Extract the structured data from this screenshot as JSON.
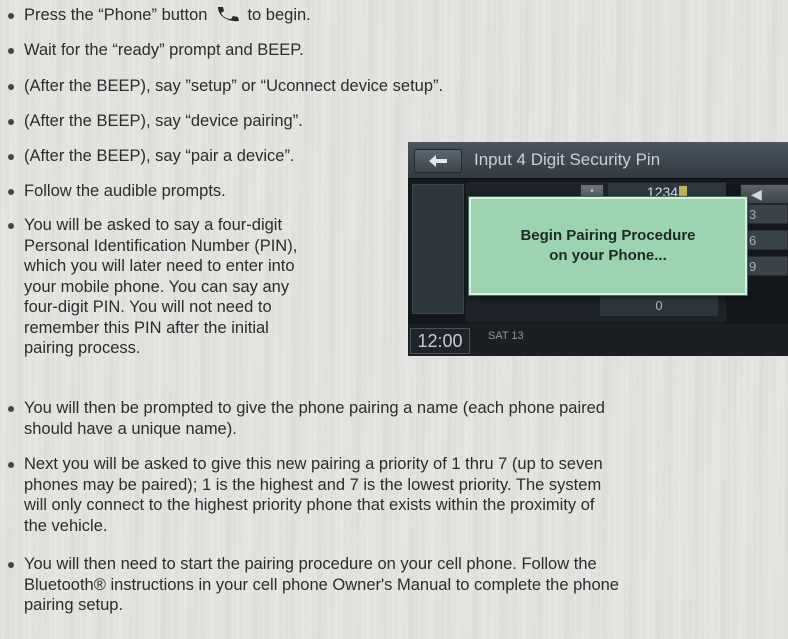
{
  "bullets": [
    {
      "pre": "Press the “Phone” button",
      "post": "to begin."
    },
    "Wait for the “ready” prompt and BEEP.",
    "(After the BEEP), say ”setup” or “Uconnect device setup”.",
    "(After the BEEP), say “device pairing”.",
    "(After the BEEP), say “pair a device”.",
    "Follow the audible prompts.",
    [
      "You will be asked to say a four-digit",
      "Personal Identification Number (PIN),",
      "which you will later need to enter into",
      "your mobile phone. You can say any",
      "four-digit PIN. You will not need to",
      "remember this PIN after the initial",
      "pairing process."
    ],
    [
      "You will then be prompted to give the phone pairing a name (each phone paired",
      "should have a unique name)."
    ],
    [
      "Next you will be asked to give this new pairing a priority of 1 thru 7 (up to seven",
      "phones may be paired); 1 is the highest and 7 is the lowest priority. The system",
      "will only connect to the highest priority phone that exists within the proximity of",
      "the vehicle."
    ],
    [
      "You will then need to start the pairing procedure on your cell phone. Follow the",
      "Bluetooth® instructions in your cell phone Owner's Manual to complete the phone",
      "pairing setup."
    ]
  ],
  "icons": {
    "phone_button": "phone-handset-icon",
    "back": "back-arrow-icon"
  },
  "screen": {
    "title": "Input 4 Digit Security Pin",
    "pin_value": "1234",
    "clear_key": "*",
    "keys_right": [
      "3",
      "6",
      "9"
    ],
    "key_zero": "0",
    "dialog_line1": "Begin Pairing Procedure",
    "dialog_line2": "on your Phone...",
    "clock": "12:00",
    "date": "SAT  13"
  },
  "colors": {
    "dialog_bg": "#9cd4b0",
    "pin_cursor": "#c4b257",
    "screen_bg": "#14181c"
  }
}
